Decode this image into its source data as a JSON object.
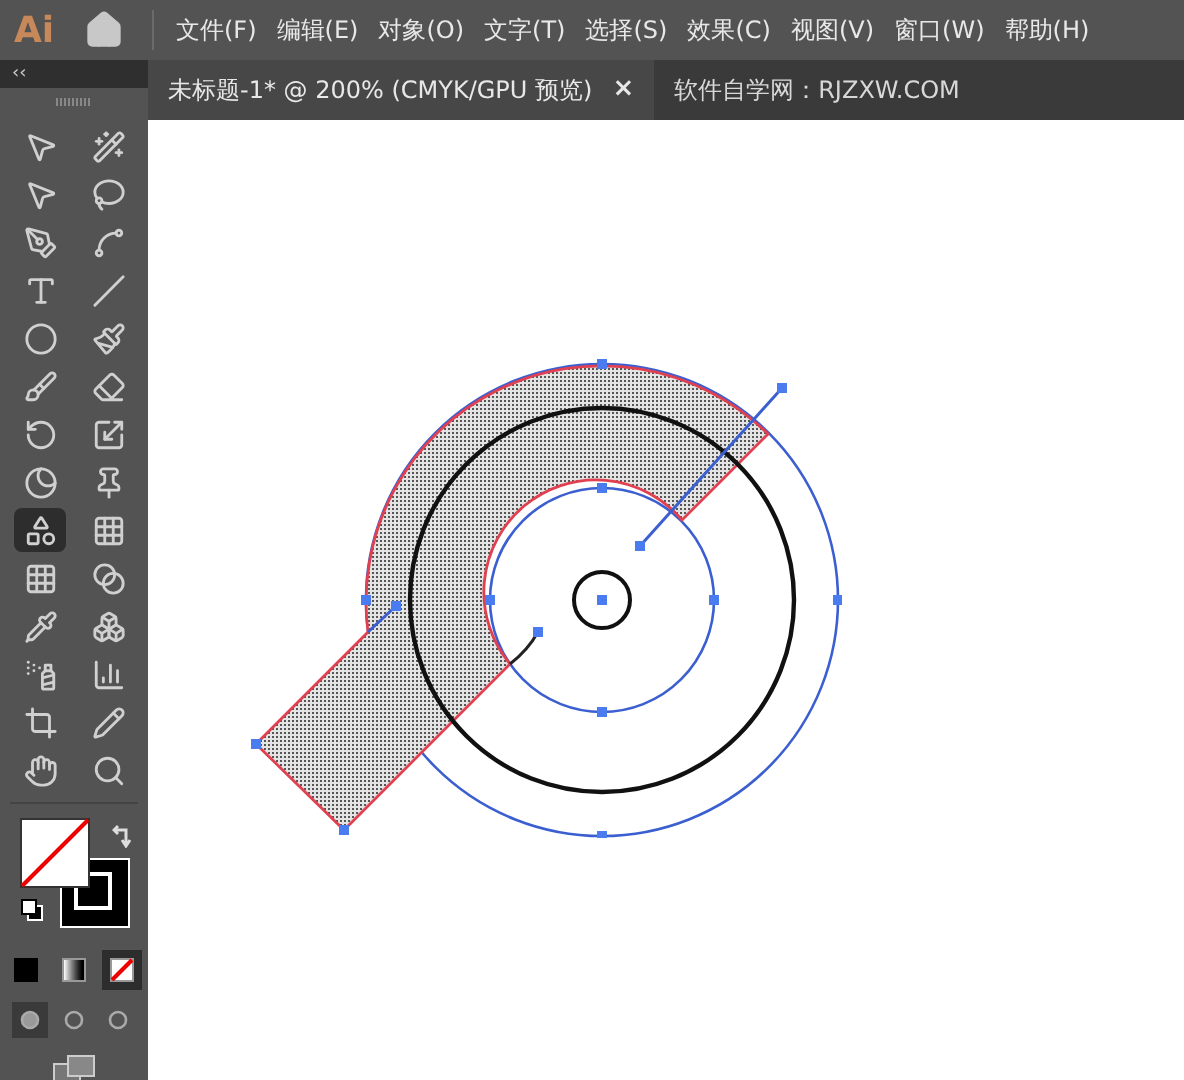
{
  "app_logo": "Ai",
  "menu": [
    "文件(F)",
    "编辑(E)",
    "对象(O)",
    "文字(T)",
    "选择(S)",
    "效果(C)",
    "视图(V)",
    "窗口(W)",
    "帮助(H)"
  ],
  "panel_collapse": "‹‹",
  "tabs": [
    {
      "label": "未标题-1* @ 200% (CMYK/GPU 预览)",
      "selected": true,
      "close": "×"
    },
    {
      "label": "软件自学网：RJZXW.COM",
      "selected": false
    }
  ],
  "tools": [
    {
      "selected": false
    },
    {
      "selected": false
    },
    {
      "selected": false
    },
    {
      "selected": false
    },
    {
      "selected": false
    },
    {
      "selected": false
    },
    {
      "selected": false
    },
    {
      "selected": false
    },
    {
      "selected": false
    },
    {
      "selected": false
    },
    {
      "selected": false
    },
    {
      "selected": false
    },
    {
      "selected": false
    },
    {
      "selected": false
    },
    {
      "selected": false
    },
    {
      "selected": false
    },
    {
      "selected": true
    },
    {
      "selected": false
    },
    {
      "selected": false
    },
    {
      "selected": false
    },
    {
      "selected": false
    },
    {
      "selected": false
    },
    {
      "selected": false
    },
    {
      "selected": false
    },
    {
      "selected": false
    },
    {
      "selected": false
    },
    {
      "selected": false
    },
    {
      "selected": false
    }
  ],
  "color_modes": [
    {
      "kind": "color",
      "selected": false
    },
    {
      "kind": "gradient",
      "selected": false
    },
    {
      "kind": "none",
      "selected": true
    }
  ],
  "draw_modes": [
    {
      "selected": true
    },
    {
      "selected": false
    },
    {
      "selected": false
    }
  ]
}
